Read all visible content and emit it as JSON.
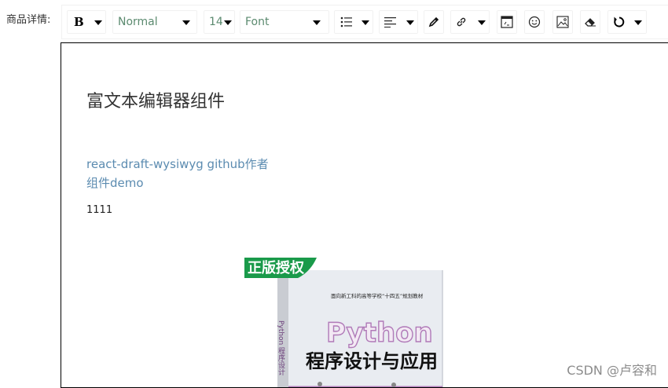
{
  "form": {
    "label": "商品详情:"
  },
  "toolbar": {
    "bold_icon": "bold-icon",
    "block_type": "Normal",
    "font_size": "14",
    "font_family": "Font",
    "icons": [
      "bold-icon",
      "list-icon",
      "align-left-icon",
      "color-picker-icon",
      "link-icon",
      "embed-icon",
      "emoji-icon",
      "image-icon",
      "eraser-icon",
      "undo-icon"
    ]
  },
  "editor": {
    "heading": "富文本编辑器组件",
    "link1": "react-draft-wysiwyg github作者",
    "link2": "组件demo",
    "paragraph": "1111",
    "image": {
      "ribbon": "正版授权",
      "subtitle": "面向新工科的高等学校“十四五”规划教材",
      "title_en": "Python",
      "title_cn": "程序设计与应用",
      "spine": "Python 程序设计"
    }
  },
  "watermark": "CSDN @卢容和",
  "colors": {
    "link": "#5b8bb0",
    "dropdown_text": "#5b8a6f",
    "ribbon_green": "#1a9a4a",
    "title_purple": "#b07ab8"
  }
}
